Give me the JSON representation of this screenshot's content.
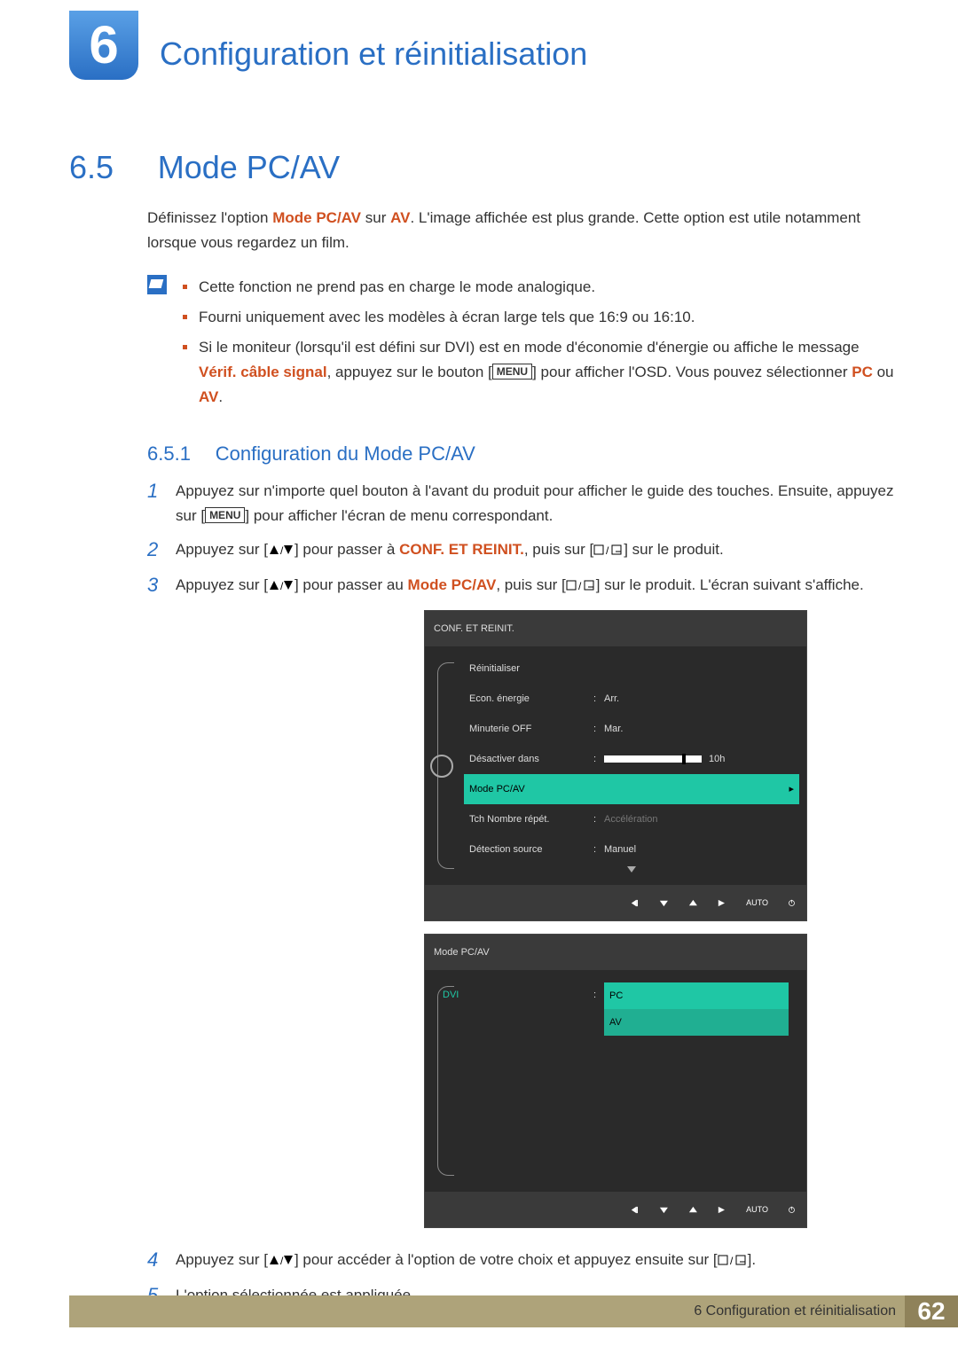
{
  "chapter": {
    "badge": "6",
    "title": "Configuration et réinitialisation"
  },
  "section": {
    "num": "6.5",
    "title": "Mode PC/AV"
  },
  "intro": {
    "pre": "Définissez l'option ",
    "em": "Mode PC/AV",
    "mid": " sur ",
    "em2": "AV",
    "post": ". L'image affichée est plus grande. Cette option est utile notamment lorsque vous regardez un film."
  },
  "notes": {
    "b1": "Cette fonction ne prend pas en charge le mode analogique.",
    "b2": "Fourni uniquement avec les modèles à écran large tels que 16:9 ou 16:10.",
    "b3_pre": "Si le moniteur (lorsqu'il est défini sur DVI) est en mode d'économie d'énergie ou affiche le message ",
    "b3_em": "Vérif. câble signal",
    "b3_mid": ", appuyez sur le bouton [",
    "b3_menu": "MENU",
    "b3_mid2": "] pour afficher l'OSD. Vous pouvez sélectionner ",
    "b3_pc": "PC",
    "b3_or": " ou ",
    "b3_av": "AV",
    "b3_end": "."
  },
  "subsection": {
    "num": "6.5.1",
    "title": "Configuration du Mode PC/AV"
  },
  "steps": {
    "s1_pre": "Appuyez sur n'importe quel bouton à l'avant du produit pour afficher le guide des touches. Ensuite, appuyez sur [",
    "s1_menu": "MENU",
    "s1_post": "] pour afficher l'écran de menu correspondant.",
    "s2_pre": "Appuyez sur [",
    "s2_mid": "] pour passer à ",
    "s2_em": "CONF. ET REINIT.",
    "s2_mid2": ", puis sur [",
    "s2_post": "] sur le produit.",
    "s3_pre": "Appuyez sur [",
    "s3_mid": "] pour passer au ",
    "s3_em": "Mode PC/AV",
    "s3_mid2": ", puis sur [",
    "s3_post": "] sur le produit. L'écran suivant s'affiche.",
    "s4_pre": "Appuyez sur [",
    "s4_mid": "] pour accéder à l'option de votre choix et appuyez ensuite sur [",
    "s4_post": "].",
    "s5": "L'option sélectionnée est appliquée."
  },
  "osd1": {
    "title": "CONF. ET REINIT.",
    "r1": "Réinitialiser",
    "r2k": "Econ. énergie",
    "r2v": "Arr.",
    "r3k": "Minuterie OFF",
    "r3v": "Mar.",
    "r4k": "Désactiver dans",
    "r4v": "10h",
    "r5k": "Mode PC/AV",
    "r6k": "Tch Nombre répét.",
    "r6v": "Accélération",
    "r7k": "Détection source",
    "r7v": "Manuel",
    "nav_auto": "AUTO"
  },
  "osd2": {
    "title": "Mode PC/AV",
    "r1k": "DVI",
    "r1v1": "PC",
    "r1v2": "AV",
    "nav_auto": "AUTO"
  },
  "footer": {
    "text": "6 Configuration et réinitialisation",
    "page": "62"
  }
}
